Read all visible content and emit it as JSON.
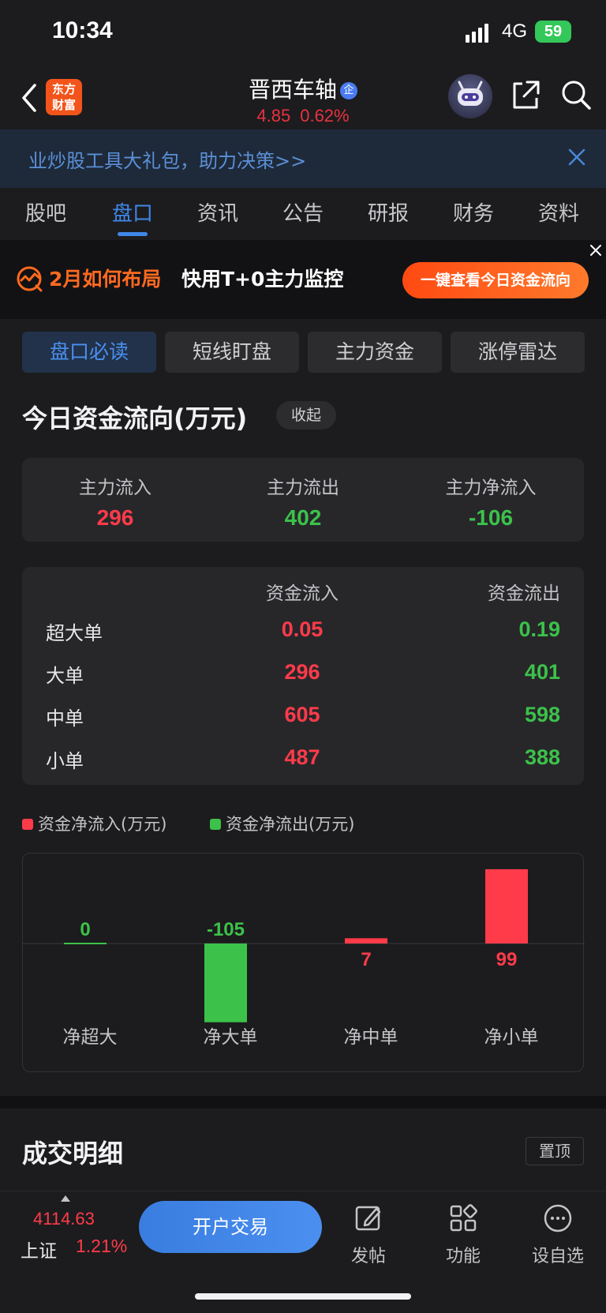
{
  "status_bar": {
    "time": "10:34",
    "network": "4G",
    "battery": "59"
  },
  "header": {
    "brand": {
      "line1": "东方",
      "line2": "财富"
    },
    "stock_name": "晋西车轴",
    "badge": "企",
    "price": "4.85",
    "change_pct": "0.62%"
  },
  "notice": {
    "text": "业炒股工具大礼包，助力决策>>"
  },
  "tabs": [
    "股吧",
    "盘口",
    "资讯",
    "公告",
    "研报",
    "财务",
    "资料"
  ],
  "active_tab": "盘口",
  "promo": {
    "title": "2月如何布局",
    "subtitle": "快用T+0主力监控",
    "button": "一键查看今日资金流向"
  },
  "segments": [
    "盘口必读",
    "短线盯盘",
    "主力资金",
    "涨停雷达"
  ],
  "fund_flow": {
    "title": "今日资金流向(万元)",
    "collapse_label": "收起",
    "summary": [
      {
        "label": "主力流入",
        "value": "296"
      },
      {
        "label": "主力流出",
        "value": "402"
      },
      {
        "label": "主力净流入",
        "value": "-106"
      }
    ],
    "table": {
      "headers": {
        "inflow": "资金流入",
        "outflow": "资金流出"
      },
      "rows": [
        {
          "label": "超大单",
          "in": "0.05",
          "out": "0.19"
        },
        {
          "label": "大单",
          "in": "296",
          "out": "401"
        },
        {
          "label": "中单",
          "in": "605",
          "out": "598"
        },
        {
          "label": "小单",
          "in": "487",
          "out": "388"
        }
      ]
    },
    "legend": {
      "inflow": "资金净流入(万元)",
      "outflow": "资金净流出(万元)"
    }
  },
  "chart_data": {
    "type": "bar",
    "categories": [
      "净超大",
      "净大单",
      "净中单",
      "净小单"
    ],
    "values": [
      0,
      -105,
      7,
      99
    ],
    "value_labels": [
      "0",
      "-105",
      "7",
      "99"
    ],
    "colors": {
      "positive": "#ff3b4a",
      "negative": "#3cc24a",
      "zero": "#3cc24a"
    }
  },
  "trade_detail": {
    "title": "成交明细",
    "pin_label": "置顶"
  },
  "bottom_bar": {
    "index_value": "4114.63",
    "index_name": "上证",
    "index_pct": "1.21%",
    "open_button": "开户交易",
    "items": [
      {
        "label": "发帖",
        "icon": "edit-icon"
      },
      {
        "label": "功能",
        "icon": "grid-icon"
      },
      {
        "label": "设自选",
        "icon": "more-icon"
      }
    ]
  }
}
